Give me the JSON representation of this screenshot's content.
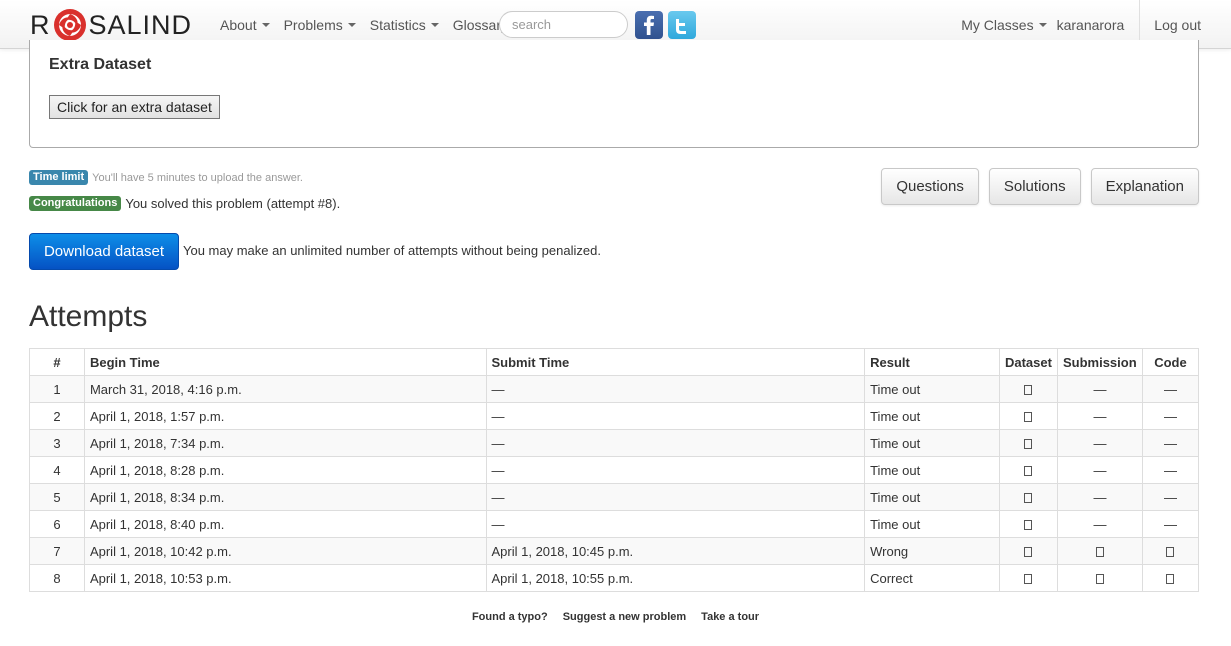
{
  "nav": {
    "brand_left": "R",
    "brand_right": "SALIND",
    "menu": [
      {
        "label": "About",
        "dropdown": true
      },
      {
        "label": "Problems",
        "dropdown": true
      },
      {
        "label": "Statistics",
        "dropdown": true
      },
      {
        "label": "Glossary",
        "dropdown": false
      }
    ],
    "search_placeholder": "search",
    "social": [
      "facebook-icon",
      "twitter-icon"
    ],
    "my_classes": "My Classes",
    "username": "karanarora",
    "logout": "Log out"
  },
  "extra_dataset": {
    "title": "Extra Dataset",
    "button": "Click for an extra dataset"
  },
  "status": {
    "time_limit_badge": "Time limit",
    "time_limit_text": "You'll have 5 minutes to upload the answer.",
    "congrats_badge": "Congratulations",
    "congrats_text": "You solved this problem (attempt #8)."
  },
  "actions": {
    "questions": "Questions",
    "solutions": "Solutions",
    "explanation": "Explanation"
  },
  "download": {
    "button": "Download dataset",
    "note": "You may make an unlimited number of attempts without being penalized."
  },
  "attempts": {
    "heading": "Attempts",
    "columns": [
      "#",
      "Begin Time",
      "Submit Time",
      "Result",
      "Dataset",
      "Submission",
      "Code"
    ],
    "rows": [
      {
        "num": "1",
        "begin": "March 31, 2018, 4:16 p.m.",
        "submit": "—",
        "result": "Time out",
        "submission": "—",
        "code": "—"
      },
      {
        "num": "2",
        "begin": "April 1, 2018, 1:57 p.m.",
        "submit": "—",
        "result": "Time out",
        "submission": "—",
        "code": "—"
      },
      {
        "num": "3",
        "begin": "April 1, 2018, 7:34 p.m.",
        "submit": "—",
        "result": "Time out",
        "submission": "—",
        "code": "—"
      },
      {
        "num": "4",
        "begin": "April 1, 2018, 8:28 p.m.",
        "submit": "—",
        "result": "Time out",
        "submission": "—",
        "code": "—"
      },
      {
        "num": "5",
        "begin": "April 1, 2018, 8:34 p.m.",
        "submit": "—",
        "result": "Time out",
        "submission": "—",
        "code": "—"
      },
      {
        "num": "6",
        "begin": "April 1, 2018, 8:40 p.m.",
        "submit": "—",
        "result": "Time out",
        "submission": "—",
        "code": "—"
      },
      {
        "num": "7",
        "begin": "April 1, 2018, 10:42 p.m.",
        "submit": "April 1, 2018, 10:45 p.m.",
        "result": "Wrong",
        "submission": "icon",
        "code": "icon"
      },
      {
        "num": "8",
        "begin": "April 1, 2018, 10:53 p.m.",
        "submit": "April 1, 2018, 10:55 p.m.",
        "result": "Correct",
        "submission": "icon",
        "code": "icon"
      }
    ]
  },
  "footer": {
    "typo": "Found a typo?",
    "suggest": "Suggest a new problem",
    "tour": "Take a tour"
  },
  "colors": {
    "time_badge": "#3a87ad",
    "congrats_badge": "#468847",
    "download_button": "#0a6fd8",
    "logo_red": "#d9302c"
  }
}
